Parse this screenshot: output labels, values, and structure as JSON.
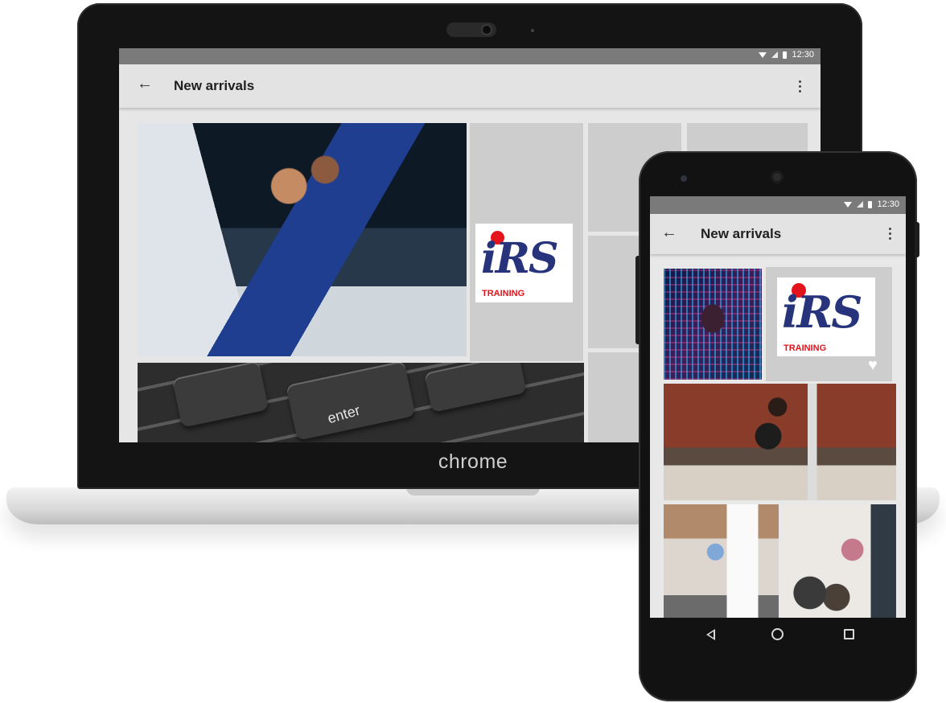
{
  "device_label": "chrome",
  "status_bar": {
    "time": "12:30"
  },
  "app_bar": {
    "title": "New arrivals",
    "back_icon": "arrow-back-icon",
    "menu_icon": "more-vert-icon"
  },
  "logo": {
    "letters": "iRS",
    "subtitle": "TRAINING"
  },
  "keyboard": {
    "key_label": "enter"
  },
  "colors": {
    "status_bar": "#7a7a7a",
    "app_bar": "#e3e3e3",
    "tile_placeholder": "#cdcdcd",
    "logo_blue": "#27337a",
    "logo_red": "#e3141b"
  },
  "phone_nav": {
    "back_icon": "nav-back-icon",
    "home_icon": "nav-home-icon",
    "recents_icon": "nav-recents-icon"
  },
  "favorite_icon": "heart-icon"
}
